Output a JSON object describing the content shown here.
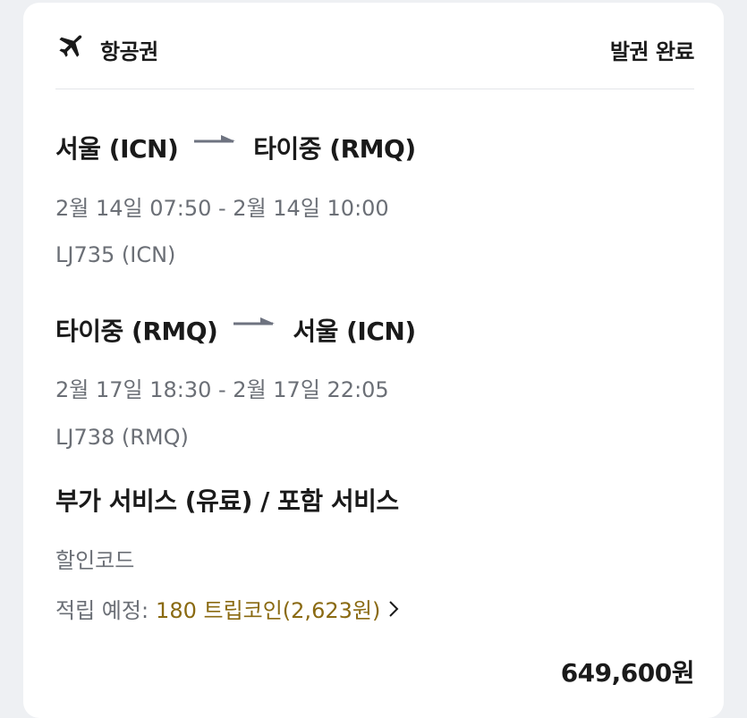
{
  "header": {
    "title": "항공권",
    "status": "발권 완료",
    "icon": "airplane-icon"
  },
  "flights": [
    {
      "origin": "서울 (ICN)",
      "destination": "타이중 (RMQ)",
      "schedule": "2월 14일 07:50 - 2월 14일 10:00",
      "flight_number": "LJ735 (ICN)"
    },
    {
      "origin": "타이중 (RMQ)",
      "destination": "서울 (ICN)",
      "schedule": "2월 17일 18:30 - 2월 17일 22:05",
      "flight_number": "LJ738 (RMQ)"
    }
  ],
  "extras": {
    "title": "부가 서비스 (유료) / 포함 서비스",
    "discount_code_label": "할인코드",
    "points_label": "적립 예정:",
    "points_value": "180 트립코인(2,623원)"
  },
  "total": "649,600원",
  "colors": {
    "text_primary": "#1a1a1a",
    "text_secondary": "#6b6f76",
    "accent_gold": "#8a6a12",
    "arrow": "#6e7380"
  }
}
